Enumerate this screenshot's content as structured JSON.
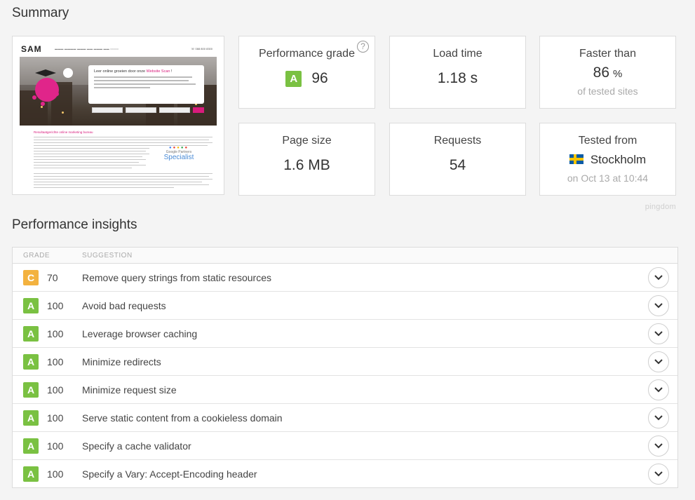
{
  "summary": {
    "title": "Summary",
    "screenshot": {
      "logo": "SAM",
      "phone": "☏ 088 800 8300",
      "bubble_heading": "Leer online groeien door onze",
      "bubble_heading_accent": "Website Scan",
      "body_title": "Resultaatgerichte online marketing bureau",
      "badge_small": "Google Partners",
      "badge_large": "Specialist"
    },
    "performance_grade": {
      "label": "Performance grade",
      "grade": "A",
      "value": "96",
      "help": "?"
    },
    "load_time": {
      "label": "Load time",
      "value": "1.18 s"
    },
    "faster_than": {
      "label": "Faster than",
      "value": "86",
      "unit": "%",
      "sub": "of tested sites"
    },
    "page_size": {
      "label": "Page size",
      "value": "1.6 MB"
    },
    "requests": {
      "label": "Requests",
      "value": "54"
    },
    "tested_from": {
      "label": "Tested from",
      "location": "Stockholm",
      "date": "on Oct 13 at 10:44"
    },
    "brand": "pingdom"
  },
  "insights": {
    "title": "Performance insights",
    "columns": {
      "grade": "GRADE",
      "suggestion": "SUGGESTION"
    },
    "rows": [
      {
        "grade": "C",
        "score": "70",
        "suggestion": "Remove query strings from static resources"
      },
      {
        "grade": "A",
        "score": "100",
        "suggestion": "Avoid bad requests"
      },
      {
        "grade": "A",
        "score": "100",
        "suggestion": "Leverage browser caching"
      },
      {
        "grade": "A",
        "score": "100",
        "suggestion": "Minimize redirects"
      },
      {
        "grade": "A",
        "score": "100",
        "suggestion": "Minimize request size"
      },
      {
        "grade": "A",
        "score": "100",
        "suggestion": "Serve static content from a cookieless domain"
      },
      {
        "grade": "A",
        "score": "100",
        "suggestion": "Specify a cache validator"
      },
      {
        "grade": "A",
        "score": "100",
        "suggestion": "Specify a Vary: Accept-Encoding header"
      }
    ]
  },
  "colors": {
    "grade_A": "#7ac142",
    "grade_C": "#f3b23f",
    "accent_pink": "#d81b7c"
  },
  "icons": {
    "expand": "chevron-down-icon",
    "help": "question-circle-icon",
    "flag": "sweden-flag-icon"
  }
}
